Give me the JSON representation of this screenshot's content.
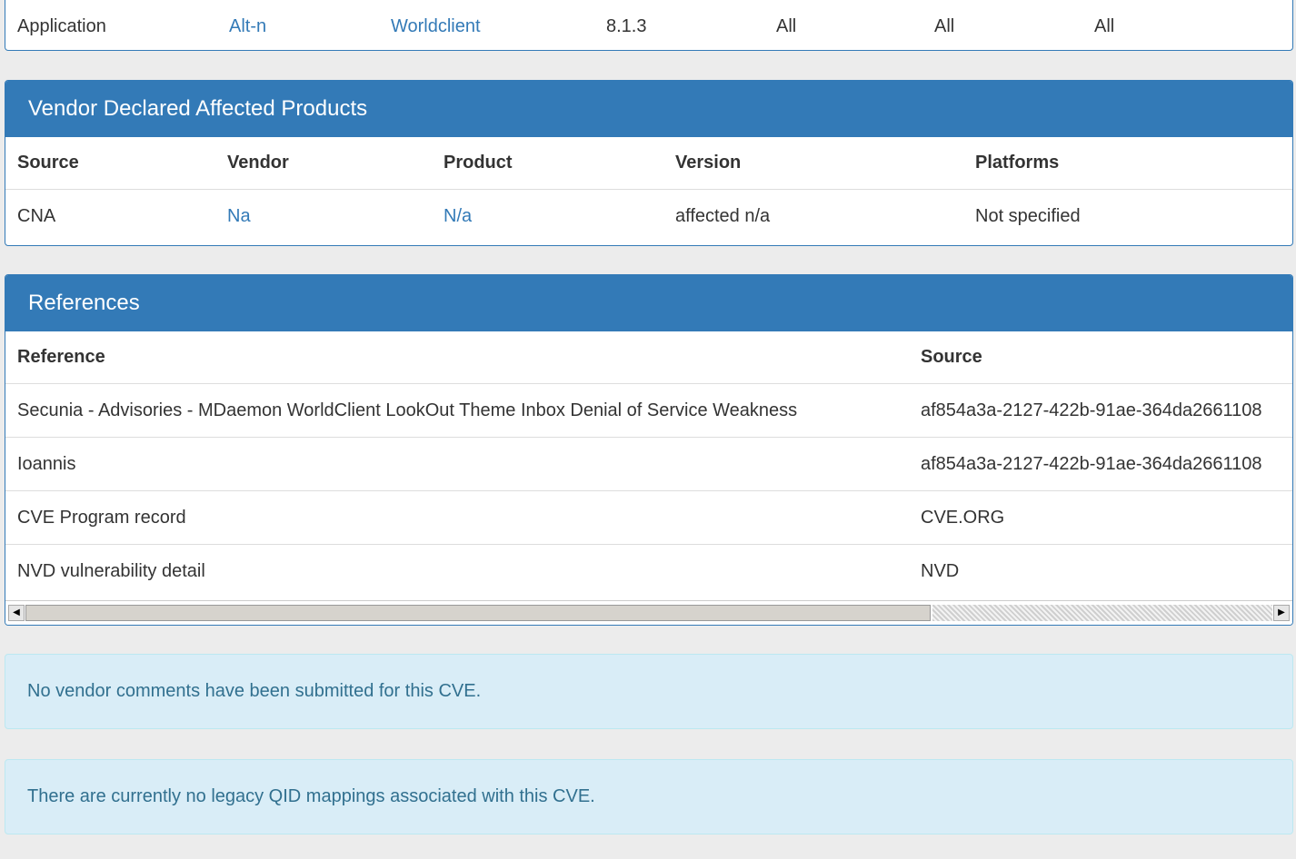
{
  "affected_products": {
    "row": {
      "type": "Application",
      "vendor": "Alt-n",
      "product": "Worldclient",
      "version": "8.1.3",
      "update": "All",
      "edition": "All",
      "language": "All"
    }
  },
  "vendor_declared": {
    "title": "Vendor Declared Affected Products",
    "headers": [
      "Source",
      "Vendor",
      "Product",
      "Version",
      "Platforms"
    ],
    "rows": [
      {
        "source": "CNA",
        "vendor": "Na",
        "product": "N/a",
        "version": "affected n/a",
        "platforms": "Not specified"
      }
    ]
  },
  "references": {
    "title": "References",
    "headers": [
      "Reference",
      "Source"
    ],
    "rows": [
      {
        "reference": "Secunia - Advisories - MDaemon WorldClient LookOut Theme Inbox Denial of Service Weakness",
        "source": "af854a3a-2127-422b-91ae-364da2661108"
      },
      {
        "reference": "Ioannis",
        "source": "af854a3a-2127-422b-91ae-364da2661108"
      },
      {
        "reference": "CVE Program record",
        "source": "CVE.ORG"
      },
      {
        "reference": "NVD vulnerability detail",
        "source": "NVD"
      }
    ],
    "scroll_position_fraction": 0.0
  },
  "alerts": {
    "vendor_comments": "No vendor comments have been submitted for this CVE.",
    "qid_mappings": "There are currently no legacy QID mappings associated with this CVE."
  },
  "icons": {
    "scroll_left": "scroll-left-arrow-icon",
    "scroll_right": "scroll-right-arrow-icon"
  },
  "colors": {
    "panel_heading": "#337ab7",
    "link": "#337ab7",
    "alert_bg": "#d9edf7",
    "alert_text": "#31708f"
  }
}
